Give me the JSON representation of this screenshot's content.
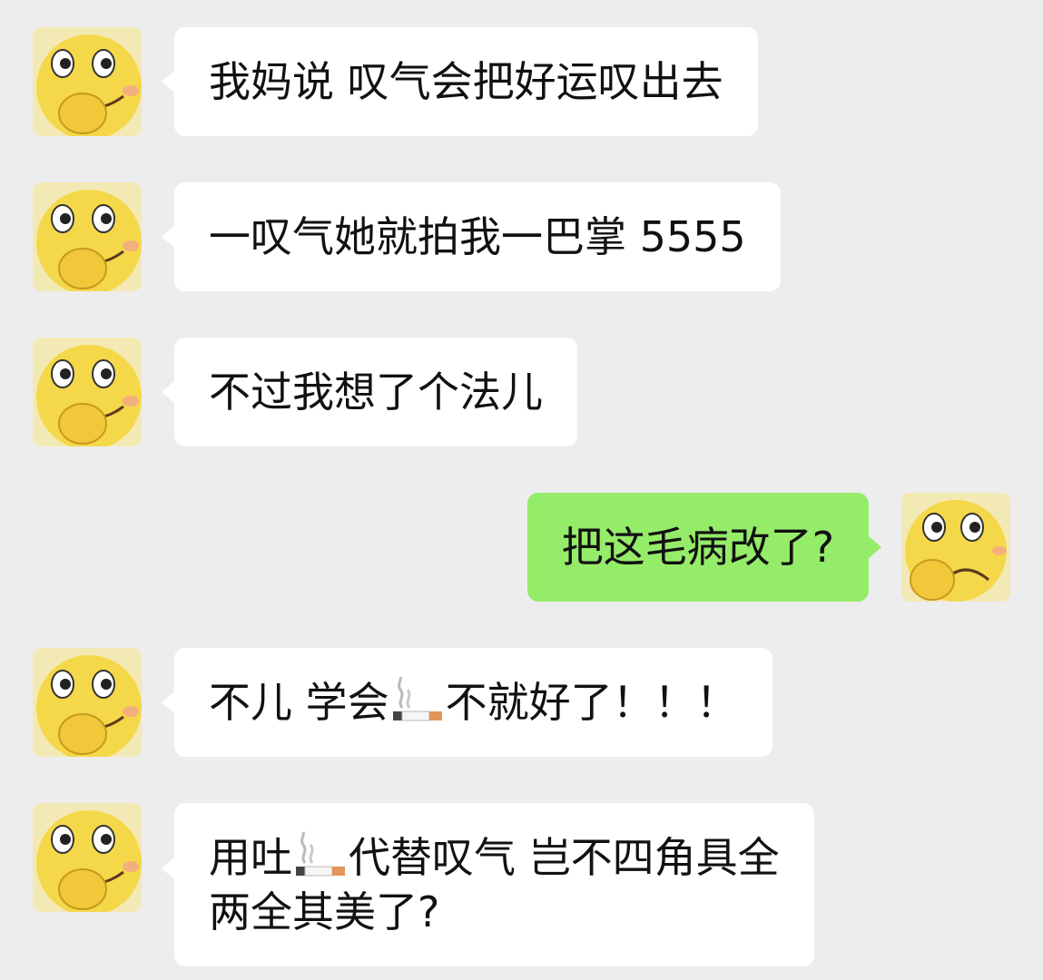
{
  "conversation": {
    "messages": [
      {
        "side": "left",
        "text": "我妈说 叹气会把好运叹出去"
      },
      {
        "side": "left",
        "text": "一叹气她就拍我一巴掌 5555"
      },
      {
        "side": "left",
        "text": "不过我想了个法儿"
      },
      {
        "side": "right",
        "text": "把这毛病改了?"
      },
      {
        "side": "left",
        "text_before": "不儿 学会",
        "emoji": "cigarette-emoji",
        "text_after": "不就好了！！！"
      },
      {
        "side": "left",
        "line1_before": "用吐",
        "emoji": "cigarette-emoji",
        "line1_after": "代替叹气 岂不四角具全",
        "line2": "两全其美了?"
      }
    ]
  },
  "colors": {
    "background": "#ededed",
    "left_bubble": "#ffffff",
    "right_bubble": "#95ec69",
    "avatar_face": "#f5d84a"
  },
  "icons": {
    "avatar_left": "smiling-emoji-avatar-icon",
    "avatar_right": "worried-emoji-avatar-icon"
  }
}
